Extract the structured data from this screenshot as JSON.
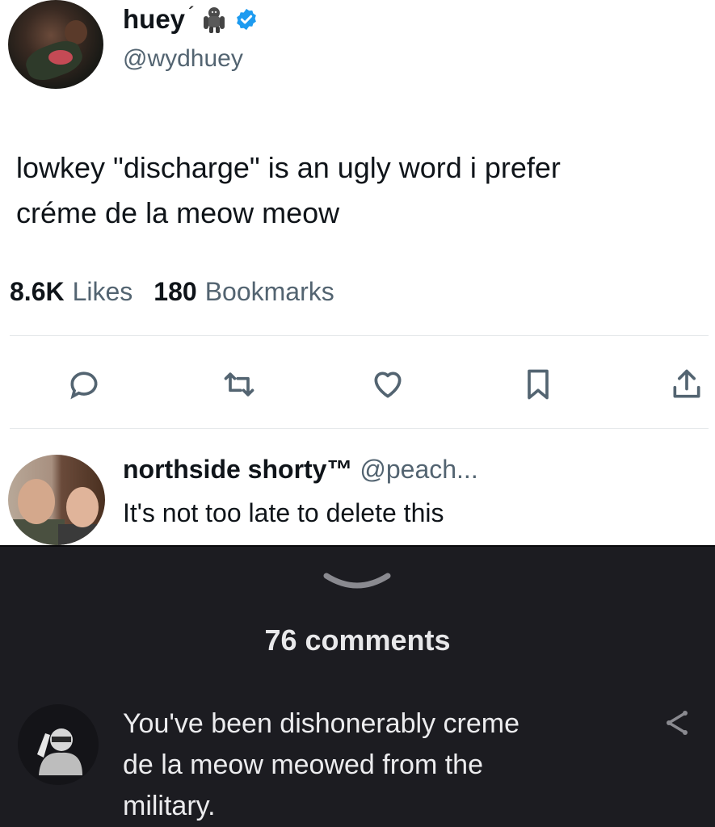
{
  "tweet": {
    "display_name": "huey",
    "name_mark": "´",
    "handle": "@wydhuey",
    "text_line1": "lowkey \"discharge\" is an ugly word i prefer",
    "text_line2": "créme de la meow meow",
    "likes_count": "8.6K",
    "likes_label": "Likes",
    "bookmarks_count": "180",
    "bookmarks_label": "Bookmarks",
    "icons": {
      "emoji": "gorilla-emoji-icon",
      "verified": "verified-badge-icon",
      "reply": "reply-icon",
      "retweet": "retweet-icon",
      "like": "heart-icon",
      "bookmark": "bookmark-icon",
      "share": "share-icon"
    },
    "colors": {
      "verified": "#1d9bf0",
      "muted": "#536471",
      "text": "#0f1419"
    }
  },
  "reply": {
    "display_name": "northside shorty™",
    "handle": "@peach...",
    "text": "It's not too late to delete this"
  },
  "comments_sheet": {
    "count_label": "76 comments",
    "comment": {
      "line1": "You've been dishonerably creme",
      "line2": "de la meow meowed from the",
      "line3": "military."
    },
    "colors": {
      "background": "#1c1c21",
      "text": "#ececee"
    }
  }
}
